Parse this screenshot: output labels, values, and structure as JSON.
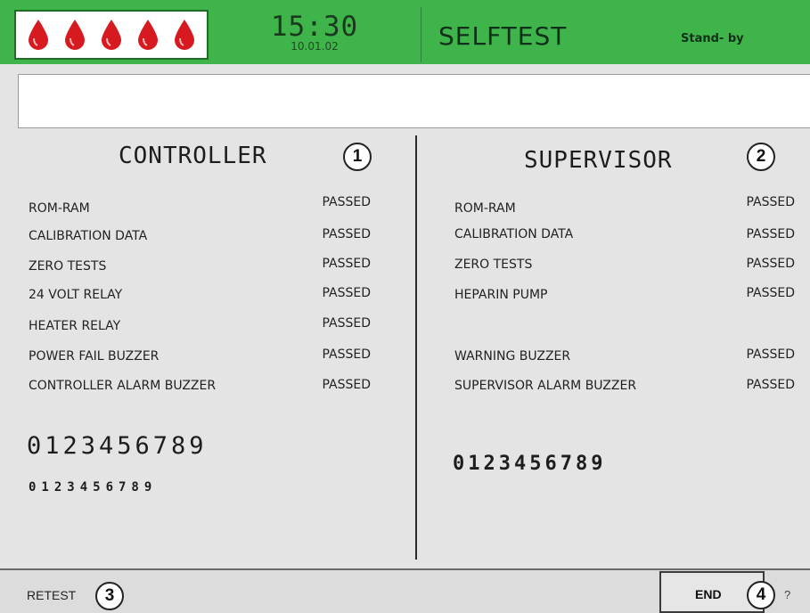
{
  "header": {
    "drops": [
      {
        "icon": "blood-drop-icon",
        "color": "#d71920"
      },
      {
        "icon": "blood-drop-icon",
        "color": "#d71920"
      },
      {
        "icon": "blood-drop-icon",
        "color": "#d71920"
      },
      {
        "icon": "blood-drop-icon",
        "color": "#d71920"
      },
      {
        "icon": "blood-drop-icon",
        "color": "#d71920"
      }
    ],
    "time": "15:30",
    "date": "10.01.02",
    "title": "SELFTEST",
    "status": "Stand- by",
    "accent_color": "#3fb44a"
  },
  "message": "",
  "controller": {
    "title": "CONTROLLER",
    "marker": "1",
    "tests": [
      {
        "label": "ROM-RAM",
        "value": "PASSED"
      },
      {
        "label": "CALIBRATION DATA",
        "value": "PASSED"
      },
      {
        "label": "ZERO TESTS",
        "value": "PASSED"
      },
      {
        "label": "24 VOLT RELAY",
        "value": "PASSED"
      },
      {
        "label": "HEATER RELAY",
        "value": "PASSED"
      },
      {
        "label": "POWER FAIL BUZZER",
        "value": "PASSED"
      },
      {
        "label": "CONTROLLER ALARM BUZZER",
        "value": "PASSED"
      }
    ],
    "digits_large": "0123456789",
    "digits_small": "0123456789"
  },
  "supervisor": {
    "title": "SUPERVISOR",
    "marker": "2",
    "tests": [
      {
        "label": "ROM-RAM",
        "value": "PASSED"
      },
      {
        "label": "CALIBRATION DATA",
        "value": "PASSED"
      },
      {
        "label": "ZERO TESTS",
        "value": "PASSED"
      },
      {
        "label": "HEPARIN PUMP",
        "value": "PASSED"
      },
      {
        "label": "WARNING BUZZER",
        "value": "PASSED"
      },
      {
        "label": "SUPERVISOR ALARM BUZZER",
        "value": "PASSED"
      }
    ],
    "digits": "0123456789"
  },
  "footer": {
    "retest_label": "RETEST",
    "retest_marker": "3",
    "end_label": "END",
    "end_marker": "4",
    "help_label": "?"
  }
}
